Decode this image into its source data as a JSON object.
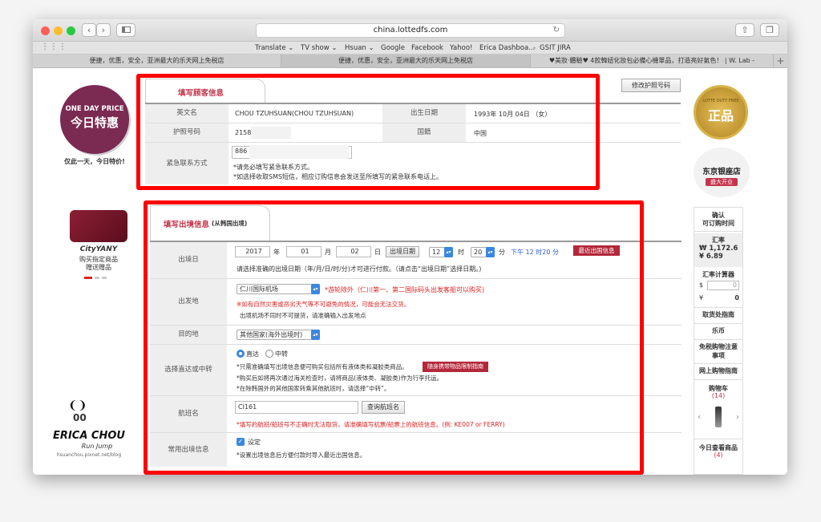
{
  "browser": {
    "url": "china.lottedfs.com",
    "bookmarks": [
      "Translate ⌄",
      "TV show ⌄",
      "Hsuan ⌄",
      "Google",
      "Facebook",
      "Yahoo!",
      "Erica Dashboa...",
      "GSIT JIRA"
    ],
    "tabs": [
      "便捷，优惠，安全，亚洲最大的乐天网上免税店",
      "便捷，优惠，安全，亚洲最大的乐天网上免税店",
      "♥美妝‧體驗♥ 4款韓妞化妝包必備心機單品，打造亮好氣色！ | W. Lab -"
    ],
    "colors": {
      "close": "#fc5f57",
      "minimize": "#fdbc2e",
      "maximize": "#28c840"
    }
  },
  "left_sidebar": {
    "badge_line1": "ONE DAY PRICE",
    "badge_line2": "今日特惠",
    "badge_caption": "仅此一天，今日特价!",
    "brand": "CityYANY",
    "promo_line1": "购买指定商品",
    "promo_line2": "赠送赠品",
    "logo_text": "ERICA CHOU",
    "logo_sub": "Run Jump",
    "logo_url": "hsuanchou.pixnet.net/blog"
  },
  "customer": {
    "tab_title": "填写顾客信息",
    "modify_button": "修改护照号码",
    "labels": {
      "english_name": "英文名",
      "birth": "出生日期",
      "passport": "护照号码",
      "nationality": "国籍",
      "emergency": "紧急联系方式"
    },
    "values": {
      "english_name": "CHOU TZUHSUAN(CHOU TZUHSUAN)",
      "birth": "1993年 10月 04日 （女）",
      "passport": "2158",
      "nationality": "中国",
      "emergency": "886"
    },
    "notes": [
      "*请务必填写紧急联系方式。",
      "*如选择收取SMS短信，相应订购信息会发送至所填写的紧急联系电话上。"
    ]
  },
  "departure": {
    "tab_title": "填写出境信息",
    "tab_sub": "(从韩国出境)",
    "date": {
      "label": "出境日",
      "year": "2017",
      "year_unit": "年",
      "month": "01",
      "month_unit": "月",
      "day": "02",
      "day_unit": "日",
      "date_button": "出境日期",
      "hour": "12",
      "hour_unit": "时",
      "minute": "20",
      "minute_unit": "分",
      "readable": "下午 12 时20 分",
      "recent_button": "最近出国信息",
      "note": "请选择准确的出境日期（年/月/日/时/分)才可进行付款。（请点击“出境日期”选择日期。)"
    },
    "origin": {
      "label": "出发地",
      "selected": "仁川国际机场",
      "red_note": "*游轮除外（仁川第一、第二国际码头出发客船可以购买)",
      "note1": "※如有自然灾害或恶劣天气等不可避免的情况，可能会无法交货。",
      "note2": "出境机场不同时不可提货，请准确输入出发地点"
    },
    "destination": {
      "label": "目的地",
      "selected": "其他国家(海外出境时)"
    },
    "route": {
      "label": "选择直达或中转",
      "direct": "直达",
      "transfer": "中转",
      "note1": "*只需准确填写出境信息便可购买包括所有液体类和凝胶类商品。",
      "guide_button": "随身携带物品限制指南",
      "note2": "*购买后如将再次通过海关检查时，请将商品(液体类、凝胶类)作为行李托运。",
      "note3": "*在除韩国外的其他国家转乘其他航班时，请选择“中转”。"
    },
    "flight": {
      "label": "航班名",
      "value": "CI161",
      "search_button": "查询航班名",
      "note": "*填写的航班/船班号不正确时无法取货，请准确填写机票/船票上的航班信息。(例: KE007 or FERRY)"
    },
    "common": {
      "label": "常用出境信息",
      "checkbox_label": "设定",
      "note": "*设置出境信息后方便付款时导入最近出国信息。"
    }
  },
  "right_sidebar": {
    "seal_line1": "LOTTE DUTY FREE",
    "seal_main": "正品",
    "store_main": "东京银座店",
    "store_sub": "盛大开业",
    "confirm_line1": "确认",
    "confirm_line2": "可订购时间",
    "rate_title": "汇率",
    "rate_won": "₩ 1,172.6",
    "rate_yen": "¥ 6.89",
    "calc_title": "汇率计算器",
    "calc_usd": "$",
    "calc_yen": "¥",
    "calc_usd_value": "0",
    "calc_yen_value": "0",
    "links": [
      "取货处指南",
      "乐币",
      "免税购物注意事项",
      "网上购物指南"
    ],
    "cart_title": "购物车",
    "cart_count": "(14)",
    "today_title": "今日查看商品",
    "today_count": "(4)",
    "prev": "‹",
    "next": "›"
  }
}
